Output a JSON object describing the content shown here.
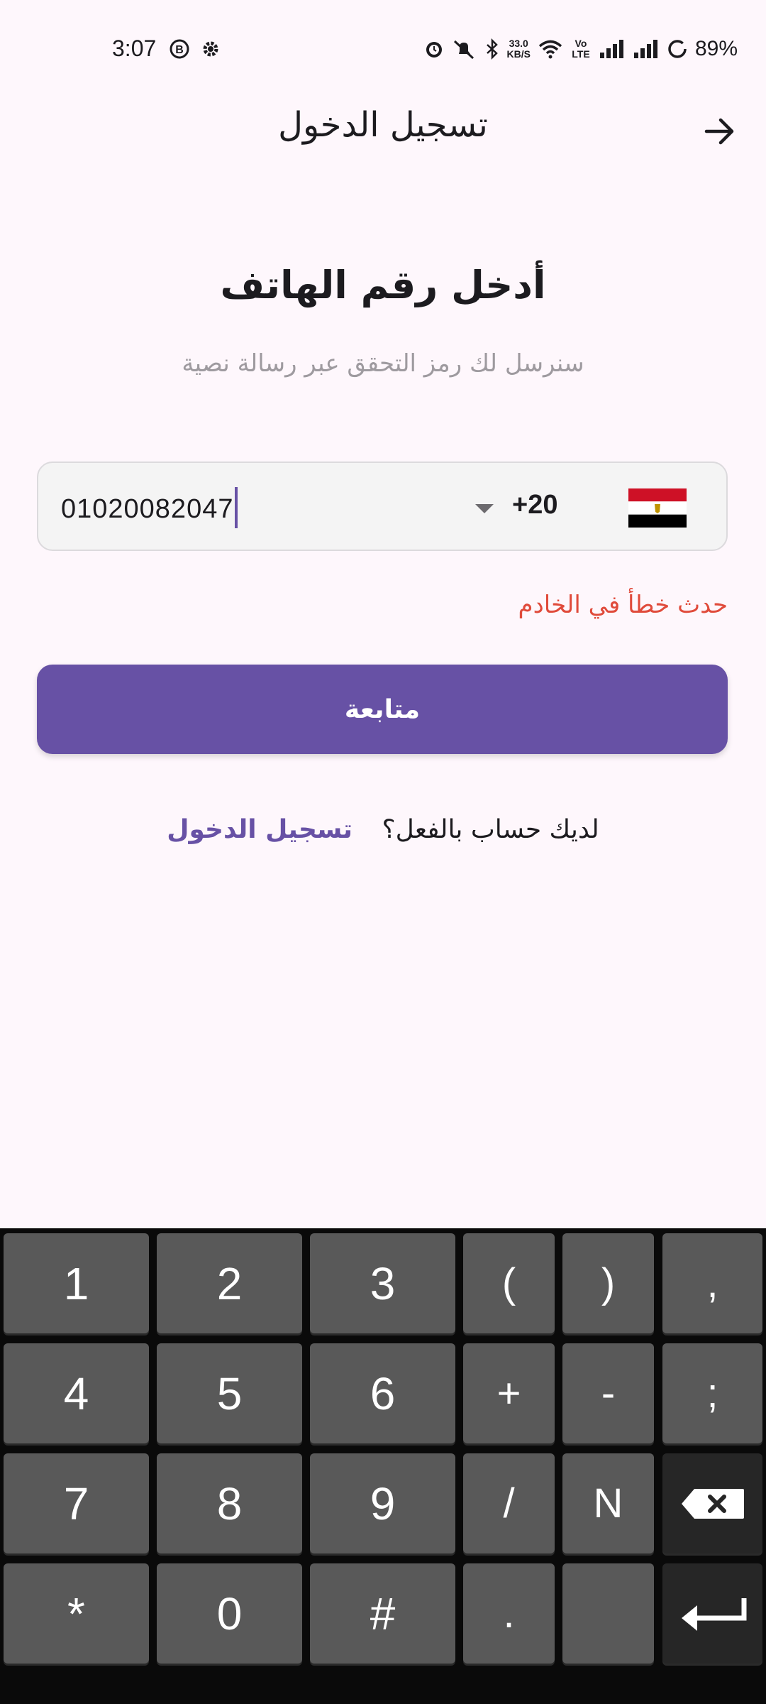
{
  "status_bar": {
    "time": "3:07",
    "net_speed_value": "33.0",
    "net_speed_unit": "KB/S",
    "volte_label": "Vo LTE",
    "battery": "89%",
    "icons": [
      "b-badge-icon",
      "settings-gear-icon",
      "alarm-icon",
      "mute-icon",
      "bluetooth-icon",
      "wifi-icon",
      "signal-icon",
      "signal-icon",
      "battery-saver-icon"
    ]
  },
  "app_bar": {
    "title": "تسجيل الدخول",
    "back_icon": "arrow-right-icon"
  },
  "main": {
    "heading": "أدخل رقم الهاتف",
    "subheading": "سنرسل لك رمز التحقق عبر رسالة نصية",
    "phone": {
      "value": "01020082047",
      "dial_code": "+20",
      "country_flag": "egypt-flag-icon"
    },
    "error": "حدث خطأ في الخادم",
    "continue_label": "متابعة",
    "have_account_text": "لديك حساب بالفعل؟",
    "login_link": "تسجيل الدخول"
  },
  "keyboard": {
    "rows": [
      [
        "1",
        "2",
        "3",
        "(",
        ")",
        ","
      ],
      [
        "4",
        "5",
        "6",
        "+",
        "-",
        ";"
      ],
      [
        "7",
        "8",
        "9",
        "/",
        "N",
        "⌫"
      ],
      [
        "*",
        "0",
        "#",
        ".",
        "",
        "↵"
      ]
    ]
  },
  "colors": {
    "background": "#FEF7FC",
    "accent": "#6751A5",
    "error": "#E04B3B",
    "key": "#595959"
  }
}
